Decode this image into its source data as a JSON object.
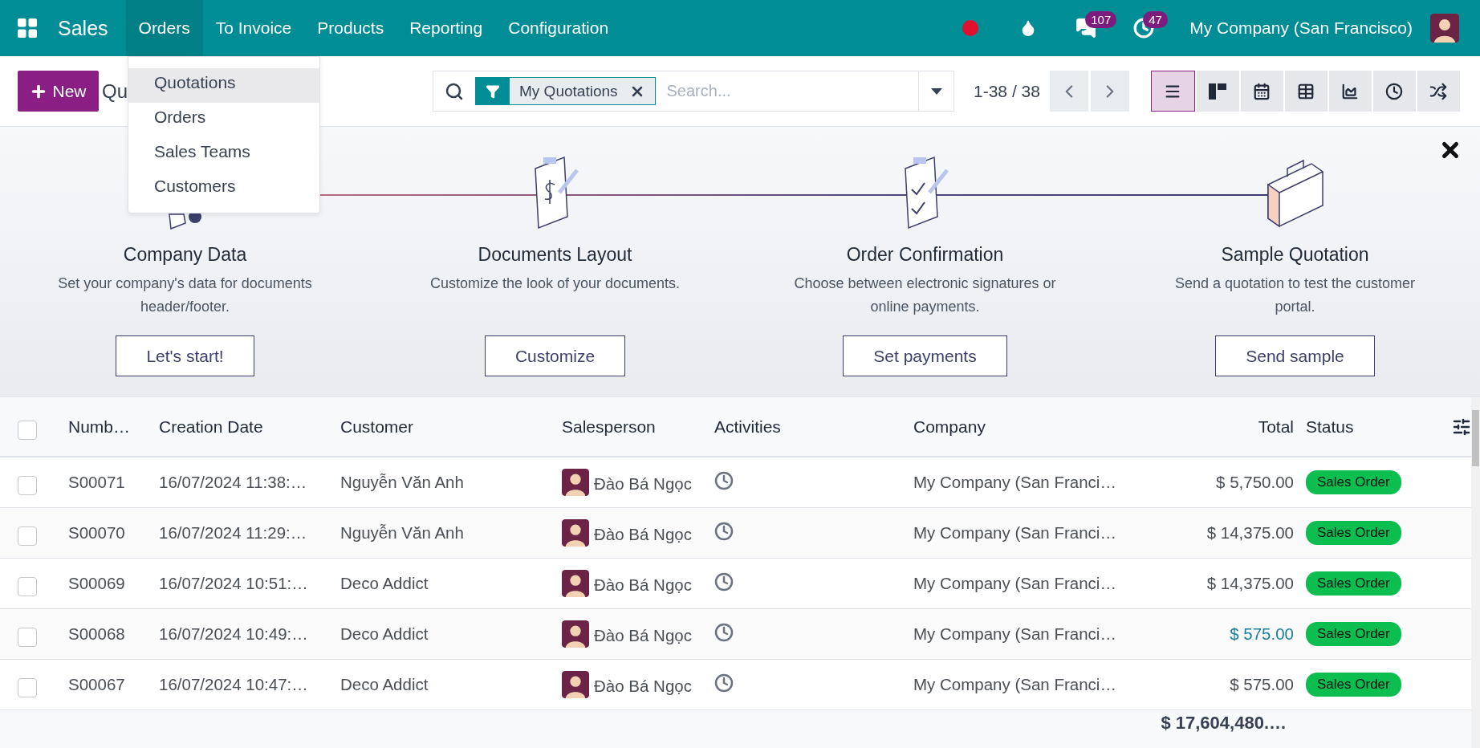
{
  "navbar": {
    "app": "Sales",
    "menus": [
      {
        "label": "Orders",
        "selected": true
      },
      {
        "label": "To Invoice",
        "selected": false
      },
      {
        "label": "Products",
        "selected": false
      },
      {
        "label": "Reporting",
        "selected": false
      },
      {
        "label": "Configuration",
        "selected": false
      }
    ],
    "indicators": [
      {
        "kind": "recording"
      },
      {
        "kind": "drop"
      },
      {
        "kind": "messages",
        "count": "107"
      },
      {
        "kind": "activities",
        "count": "47"
      }
    ],
    "company": "My Company (San Francisco)"
  },
  "orders_menu": {
    "items": [
      {
        "label": "Quotations",
        "selected": true
      },
      {
        "label": "Orders",
        "selected": false
      },
      {
        "label": "Sales Teams",
        "selected": false
      },
      {
        "label": "Customers",
        "selected": false
      }
    ]
  },
  "control_panel": {
    "new_button": "New",
    "title": "Qu",
    "filter": "My Quotations",
    "search_placeholder": "Search...",
    "pager": "1-38 / 38",
    "views": [
      {
        "kind": "list",
        "selected": true
      },
      {
        "kind": "kanban",
        "selected": false
      },
      {
        "kind": "calendar",
        "selected": false
      },
      {
        "kind": "pivot",
        "selected": false
      },
      {
        "kind": "graph",
        "selected": false
      },
      {
        "kind": "activity",
        "selected": false
      },
      {
        "kind": "cohort",
        "selected": false
      }
    ]
  },
  "onboarding": {
    "steps": [
      {
        "kind": "company",
        "title": "Company Data",
        "description": "Set your company's data for documents header/footer.",
        "button": "Let's start!"
      },
      {
        "kind": "layout",
        "title": "Documents Layout",
        "description": "Customize the look of your documents.",
        "button": "Customize"
      },
      {
        "kind": "confirmation",
        "title": "Order Confirmation",
        "description": "Choose between electronic signatures or online payments.",
        "button": "Set payments"
      },
      {
        "kind": "sample",
        "title": "Sample Quotation",
        "description": "Send a quotation to test the customer portal.",
        "button": "Send sample"
      }
    ]
  },
  "table": {
    "header_checked": false,
    "columns": [
      "Numb…",
      "Creation Date",
      "Customer",
      "Salesperson",
      "Activities",
      "Company",
      "Total",
      "Status"
    ],
    "rows": [
      {
        "checked": false,
        "number": "S00071",
        "date": "16/07/2024 11:38:…",
        "customer": "Nguyễn Văn Anh",
        "salesperson": "Đào Bá Ngọc",
        "company": "My Company (San Franci…",
        "total": "$ 5,750.00",
        "color": "#4a4f55",
        "status": "Sales Order"
      },
      {
        "checked": false,
        "number": "S00070",
        "date": "16/07/2024 11:29:…",
        "customer": "Nguyễn Văn Anh",
        "salesperson": "Đào Bá Ngọc",
        "company": "My Company (San Franci…",
        "total": "$ 14,375.00",
        "color": "#4a4f55",
        "status": "Sales Order"
      },
      {
        "checked": false,
        "number": "S00069",
        "date": "16/07/2024 10:51:…",
        "customer": "Deco Addict",
        "salesperson": "Đào Bá Ngọc",
        "company": "My Company (San Franci…",
        "total": "$ 14,375.00",
        "color": "#4a4f55",
        "status": "Sales Order"
      },
      {
        "checked": false,
        "number": "S00068",
        "date": "16/07/2024 10:49:…",
        "customer": "Deco Addict",
        "salesperson": "Đào Bá Ngọc",
        "company": "My Company (San Franci…",
        "total": "$ 575.00",
        "color": "#1b7ea0",
        "status": "Sales Order"
      },
      {
        "checked": false,
        "number": "S00067",
        "date": "16/07/2024 10:47:…",
        "customer": "Deco Addict",
        "salesperson": "Đào Bá Ngọc",
        "company": "My Company (San Franci…",
        "total": "$ 575.00",
        "color": "#4a4f55",
        "status": "Sales Order"
      }
    ],
    "footer_total": "$ 17,604,480.…"
  }
}
